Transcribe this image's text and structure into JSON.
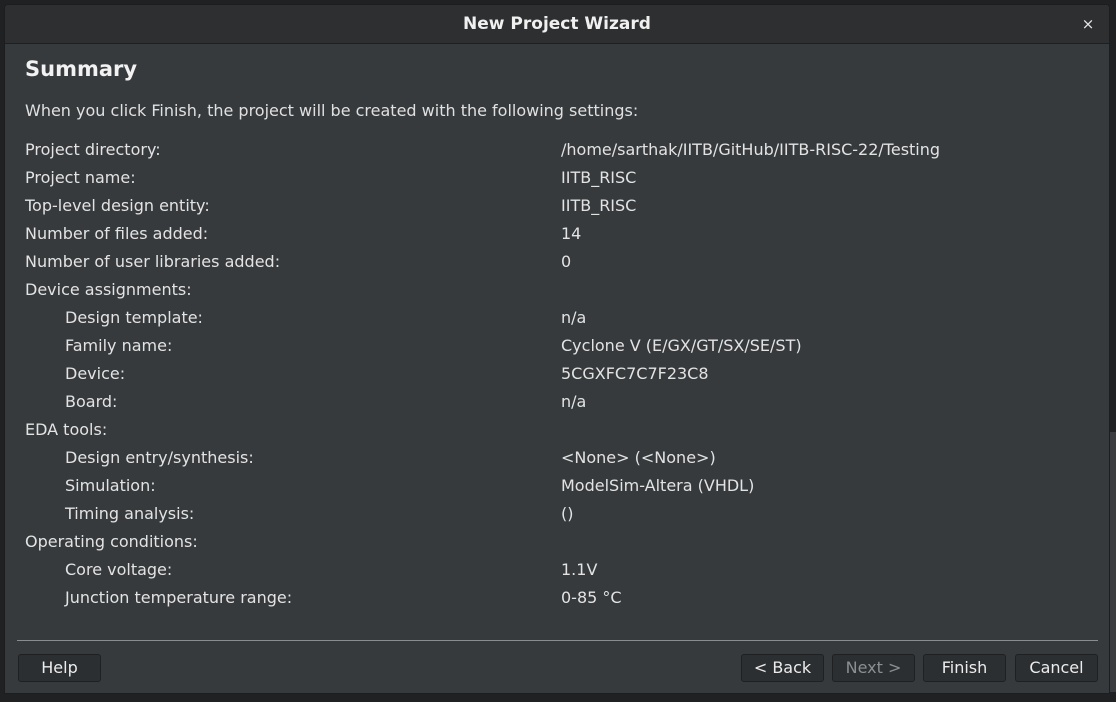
{
  "window": {
    "title": "New Project Wizard",
    "close_glyph": "×"
  },
  "page": {
    "heading": "Summary",
    "intro": "When you click Finish, the project will be created with the following settings:"
  },
  "settings": [
    {
      "label": "Project directory:",
      "value": "/home/sarthak/IITB/GitHub/IITB-RISC-22/Testing",
      "indent": false
    },
    {
      "label": "Project name:",
      "value": "IITB_RISC",
      "indent": false
    },
    {
      "label": "Top-level design entity:",
      "value": "IITB_RISC",
      "indent": false
    },
    {
      "label": "Number of files added:",
      "value": "14",
      "indent": false
    },
    {
      "label": "Number of user libraries added:",
      "value": "0",
      "indent": false
    },
    {
      "label": "Device assignments:",
      "value": "",
      "indent": false
    },
    {
      "label": "Design template:",
      "value": "n/a",
      "indent": true
    },
    {
      "label": "Family name:",
      "value": "Cyclone V (E/GX/GT/SX/SE/ST)",
      "indent": true
    },
    {
      "label": "Device:",
      "value": "5CGXFC7C7F23C8",
      "indent": true
    },
    {
      "label": "Board:",
      "value": "n/a",
      "indent": true
    },
    {
      "label": "EDA tools:",
      "value": "",
      "indent": false
    },
    {
      "label": "Design entry/synthesis:",
      "value": "<None> (<None>)",
      "indent": true
    },
    {
      "label": "Simulation:",
      "value": "ModelSim-Altera (VHDL)",
      "indent": true
    },
    {
      "label": "Timing analysis:",
      "value": " ()",
      "indent": true
    },
    {
      "label": "Operating conditions:",
      "value": "",
      "indent": false
    },
    {
      "label": "Core voltage:",
      "value": "1.1V",
      "indent": true
    },
    {
      "label": "Junction temperature range:",
      "value": "0-85 °C",
      "indent": true
    }
  ],
  "buttons": {
    "help": "Help",
    "back": "< Back",
    "next": "Next >",
    "finish": "Finish",
    "cancel": "Cancel"
  }
}
